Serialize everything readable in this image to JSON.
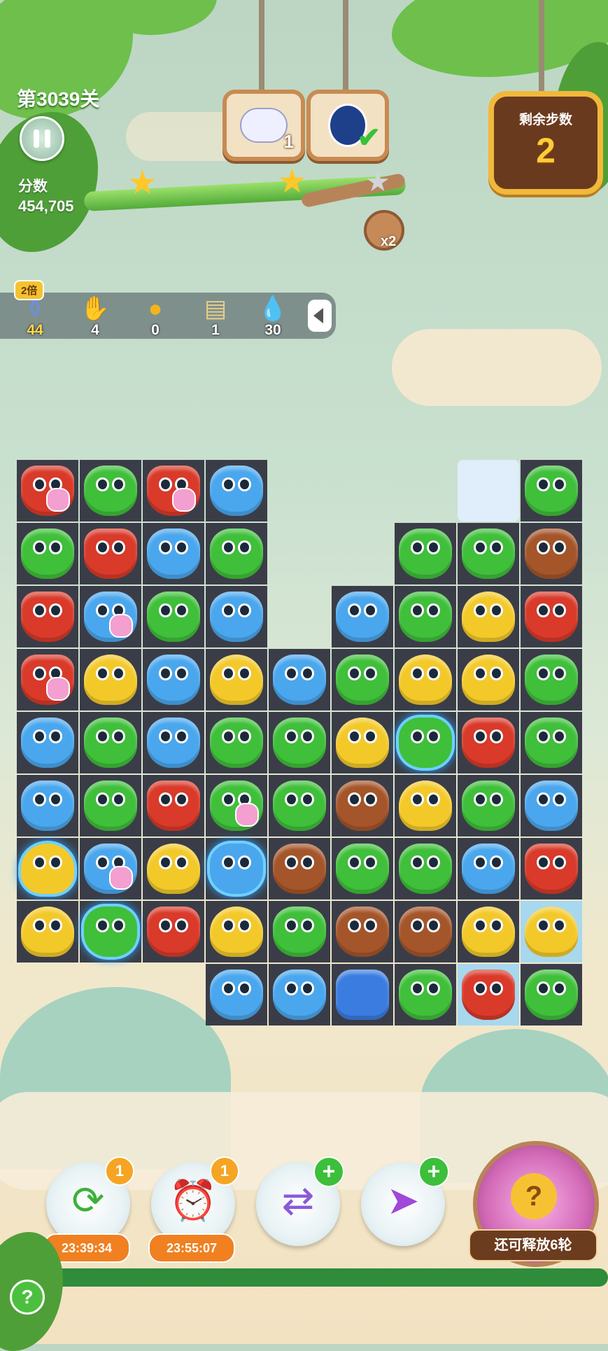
{
  "header": {
    "level": "第3039关",
    "score_label": "分数",
    "score_value": "454,705"
  },
  "goals": [
    {
      "icon": "seal-icon",
      "count": "1"
    },
    {
      "icon": "penguin-icon",
      "status": "done"
    }
  ],
  "moves": {
    "label": "剩余步数",
    "value": "2"
  },
  "star_bonus": "x2",
  "boosters": {
    "multiplier_badge": "2倍",
    "items": [
      {
        "icon": "jar-icon",
        "count": "44"
      },
      {
        "icon": "glove-icon",
        "count": "4"
      },
      {
        "icon": "golden-ball-icon",
        "count": "0"
      },
      {
        "icon": "map-icon",
        "count": "1"
      },
      {
        "icon": "water-drop-icon",
        "count": "30"
      }
    ]
  },
  "board": {
    "rows": [
      [
        "fox*",
        "frog",
        "fox*",
        "blue",
        null,
        null,
        null,
        "snow",
        "frog"
      ],
      [
        "frog",
        "fox",
        "blue",
        "frog",
        null,
        null,
        "frog",
        "frog",
        "bear"
      ],
      [
        "fox",
        "blue*",
        "frog",
        "blue",
        null,
        "blue",
        "frog",
        "chick",
        "fox"
      ],
      [
        "fox*",
        "chick",
        "blue",
        "chick",
        "blue",
        "frog",
        "chick",
        "chick",
        "frog"
      ],
      [
        "blue",
        "frog",
        "blue",
        "frog",
        "frog",
        "chick",
        "frog!",
        "fox",
        "frog"
      ],
      [
        "blue",
        "frog",
        "fox",
        "frog*",
        "frog",
        "bear",
        "chick",
        "frog",
        "blue"
      ],
      [
        "chick!",
        "blue*",
        "chick",
        "blue!",
        "bear",
        "frog",
        "frog",
        "blue",
        "fox"
      ],
      [
        "chick",
        "frog!",
        "fox",
        "chick",
        "frog",
        "bear",
        "bear",
        "chick",
        "chick~"
      ],
      [
        null,
        null,
        null,
        "blue",
        "blue",
        "flower",
        "frog",
        "fox~",
        "frog"
      ]
    ]
  },
  "powerups": [
    {
      "icon": "shuffle-icon",
      "count": "1",
      "timer": "23:39:34"
    },
    {
      "icon": "clock-icon",
      "count": "1",
      "timer": "23:55:07"
    },
    {
      "icon": "swap-icon",
      "plus": "+"
    },
    {
      "icon": "rocket-icon",
      "plus": "+"
    }
  ],
  "bag": {
    "label": "还可释放6轮",
    "icon": "lucky-bag-icon"
  },
  "help": "?"
}
